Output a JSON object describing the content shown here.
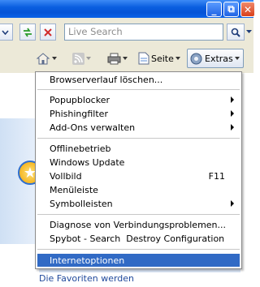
{
  "window": {
    "min": "_",
    "max": "⧉",
    "close": "✕"
  },
  "address_bar": {
    "search_placeholder": "Live Search"
  },
  "toolbar": {
    "page_label": "Seite",
    "extras_label": "Extras"
  },
  "page": {
    "favorites_text": "Die Favoriten werden"
  },
  "extras_menu": {
    "items": [
      {
        "label": "Browserverlauf löschen..."
      },
      {
        "label": "Popupblocker"
      },
      {
        "label": "Phishingfilter"
      },
      {
        "label": "Add-Ons verwalten"
      },
      {
        "label": "Offlinebetrieb"
      },
      {
        "label": "Windows Update"
      },
      {
        "label": "Vollbild",
        "shortcut": "F11"
      },
      {
        "label": "Menüleiste"
      },
      {
        "label": "Symbolleisten"
      },
      {
        "label": "Diagnose von Verbindungsproblemen..."
      },
      {
        "label": "Spybot - Search  Destroy Configuration"
      },
      {
        "label": "Internetoptionen"
      }
    ]
  },
  "colors": {
    "selection": "#316ac5",
    "toolbar_bg": "#ece9d8",
    "title_blue": "#0553d6"
  }
}
